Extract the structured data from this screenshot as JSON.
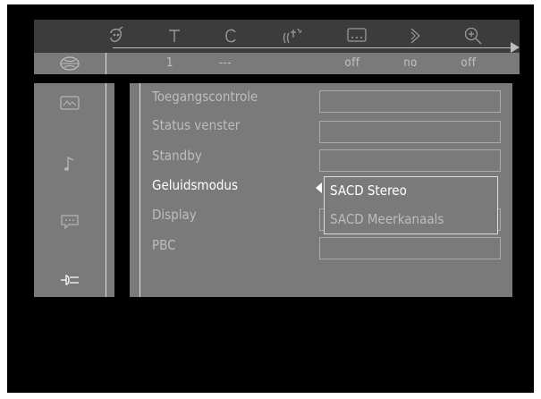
{
  "status_bar": {
    "values": [
      "1",
      "---",
      "off",
      "no",
      "off"
    ]
  },
  "menu": {
    "items": [
      {
        "label": "Toegangscontrole"
      },
      {
        "label": "Status venster"
      },
      {
        "label": "Standby"
      },
      {
        "label": "Geluidsmodus"
      },
      {
        "label": "Display"
      },
      {
        "label": "PBC"
      }
    ],
    "selected_index": 3
  },
  "sound_mode_popup": {
    "options": [
      "SACD Stereo",
      "SACD Meerkanaals"
    ],
    "selected_index": 0
  },
  "icons": {
    "top": [
      "title-icon",
      "text-icon",
      "chapter-icon",
      "audio-icon",
      "subtitle-icon",
      "angle-icon",
      "zoom-icon"
    ],
    "left": [
      "picture-icon",
      "sound-icon",
      "language-icon",
      "features-icon"
    ],
    "disc": "disc-icon"
  },
  "colors": {
    "screen_bg": "#000000",
    "panel_bg": "#7a7a7a",
    "topbar_bg": "#3c3c3c",
    "text_dim": "#bdbdbd",
    "text_active": "#ffffff"
  }
}
